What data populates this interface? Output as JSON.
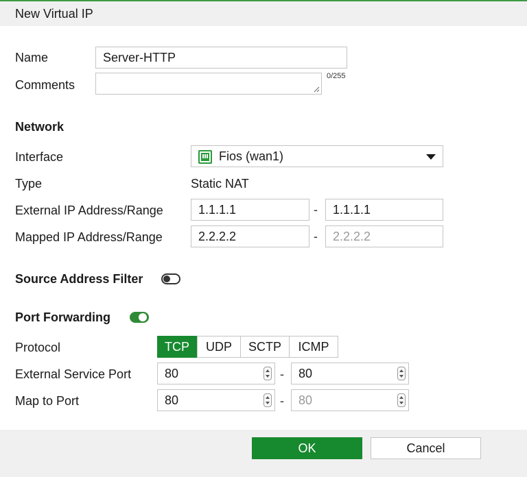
{
  "dialog": {
    "title": "New Virtual IP"
  },
  "name": {
    "label": "Name",
    "value": "Server-HTTP"
  },
  "comments": {
    "label": "Comments",
    "value": "",
    "counter": "0/255"
  },
  "network": {
    "heading": "Network",
    "interface": {
      "label": "Interface",
      "value": "Fios (wan1)",
      "icon": "network-port-icon"
    },
    "type": {
      "label": "Type",
      "value": "Static NAT"
    },
    "external_ip": {
      "label": "External IP Address/Range",
      "start": "1.1.1.1",
      "separator": "-",
      "end": "1.1.1.1"
    },
    "mapped_ip": {
      "label": "Mapped IP Address/Range",
      "start": "2.2.2.2",
      "separator": "-",
      "end_placeholder": "2.2.2.2"
    }
  },
  "source_address_filter": {
    "label": "Source Address Filter",
    "enabled": false
  },
  "port_forwarding": {
    "label": "Port Forwarding",
    "enabled": true,
    "protocol": {
      "label": "Protocol",
      "options": [
        "TCP",
        "UDP",
        "SCTP",
        "ICMP"
      ],
      "selected": "TCP"
    },
    "external_service_port": {
      "label": "External Service Port",
      "start": "80",
      "separator": "-",
      "end": "80"
    },
    "map_to_port": {
      "label": "Map to Port",
      "start": "80",
      "separator": "-",
      "end_placeholder": "80"
    }
  },
  "footer": {
    "ok_label": "OK",
    "cancel_label": "Cancel"
  },
  "colors": {
    "accent": "#17892f",
    "title_bar": "#f0f0f0",
    "border": "#c4c4c4"
  }
}
